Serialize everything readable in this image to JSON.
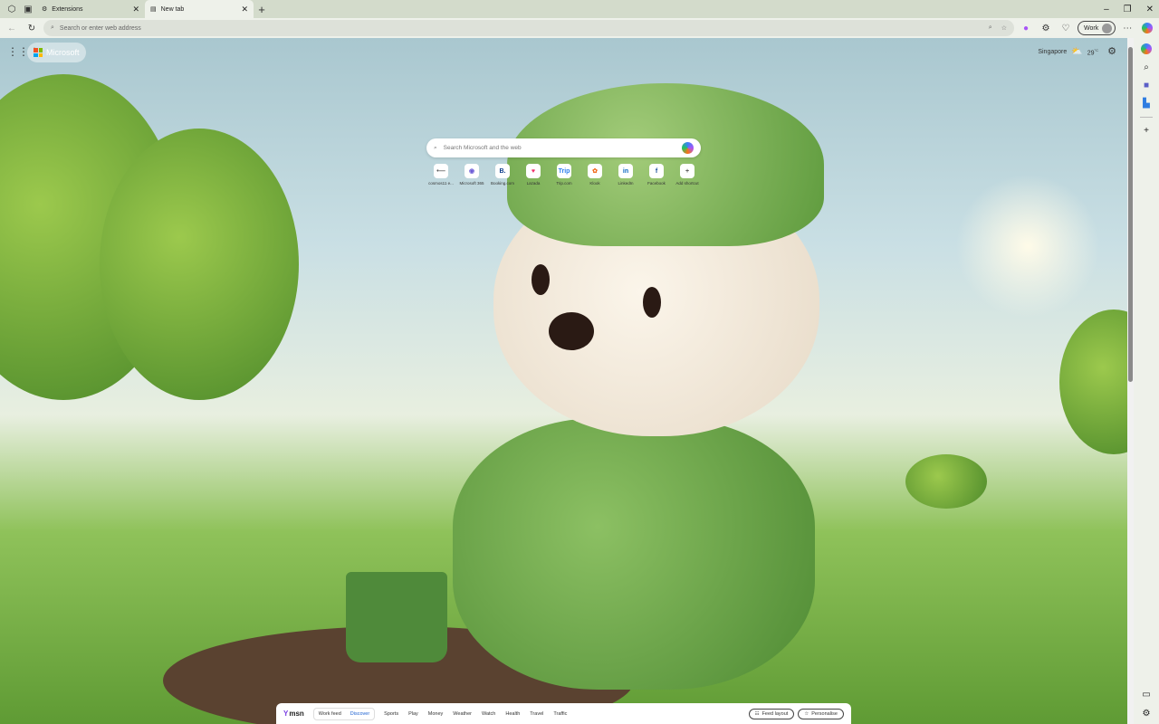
{
  "browser": {
    "tabs": [
      {
        "title": "Extensions",
        "icon": "extensions-icon",
        "active": false
      },
      {
        "title": "New tab",
        "icon": "newtab-icon",
        "active": true
      }
    ],
    "address_placeholder": "Search or enter web address",
    "profile_label": "Work"
  },
  "newtab": {
    "brand": "Microsoft",
    "weather": {
      "location": "Singapore",
      "temperature": "29",
      "unit": "°C"
    },
    "search_placeholder": "Search Microsoft and the web",
    "shortcuts": [
      {
        "label": "cosmos11 e...",
        "glyph": "•—",
        "color": "#555555"
      },
      {
        "label": "Microsoft 365",
        "glyph": "◉",
        "color": "#6b5bd6"
      },
      {
        "label": "Booking.com",
        "glyph": "B.",
        "color": "#0a3a8a"
      },
      {
        "label": "Lazada",
        "glyph": "♥",
        "color": "#f0306a"
      },
      {
        "label": "Trip.com",
        "glyph": "Trip",
        "color": "#2f80ed"
      },
      {
        "label": "Klook",
        "glyph": "✿",
        "color": "#f26b1d"
      },
      {
        "label": "LinkedIn",
        "glyph": "in",
        "color": "#0a66c2"
      },
      {
        "label": "Facebook",
        "glyph": "f",
        "color": "#1b4f9c"
      },
      {
        "label": "Add shortcut",
        "glyph": "+",
        "color": "#555555"
      }
    ]
  },
  "msn": {
    "logo": "msn",
    "feed_tabs": [
      "Work feed",
      "Discover"
    ],
    "active_feed": "Discover",
    "links": [
      "Sports",
      "Play",
      "Money",
      "Weather",
      "Watch",
      "Health",
      "Travel",
      "Traffic"
    ],
    "feed_layout_label": "Feed layout",
    "personalise_label": "Personalise"
  }
}
